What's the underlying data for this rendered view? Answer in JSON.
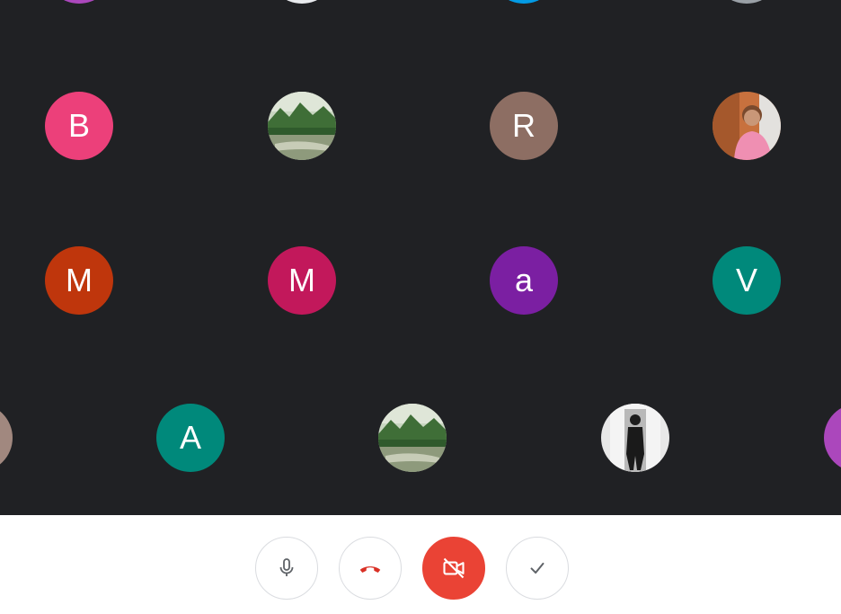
{
  "grid": {
    "background": "#202124",
    "participants": [
      {
        "type": "initial",
        "initial": "B",
        "color": "#ec407a"
      },
      {
        "type": "photo",
        "photo": "landscape"
      },
      {
        "type": "initial",
        "initial": "R",
        "color": "#8d6e63"
      },
      {
        "type": "photo",
        "photo": "person-pink-shirt"
      },
      {
        "type": "initial",
        "initial": "M",
        "color": "#bf360c"
      },
      {
        "type": "initial",
        "initial": "M",
        "color": "#c2185b"
      },
      {
        "type": "initial",
        "initial": "a",
        "color": "#7b1fa2"
      },
      {
        "type": "initial",
        "initial": "V",
        "color": "#00897b"
      },
      {
        "type": "initial",
        "initial": "A",
        "color": "#00897b"
      },
      {
        "type": "photo",
        "photo": "landscape"
      },
      {
        "type": "photo",
        "photo": "person-black-white"
      },
      {
        "type": "partial",
        "color": "#ab47bc"
      },
      {
        "type": "partial",
        "color": "#a1887f"
      }
    ]
  },
  "controls": {
    "mic": {
      "icon": "microphone-icon",
      "color": "#5f6368"
    },
    "end_call": {
      "icon": "phone-hangup-icon",
      "color": "#d93025"
    },
    "camera": {
      "icon": "camera-off-icon",
      "background": "#ea4335"
    },
    "check": {
      "icon": "check-icon",
      "color": "#5f6368"
    }
  }
}
